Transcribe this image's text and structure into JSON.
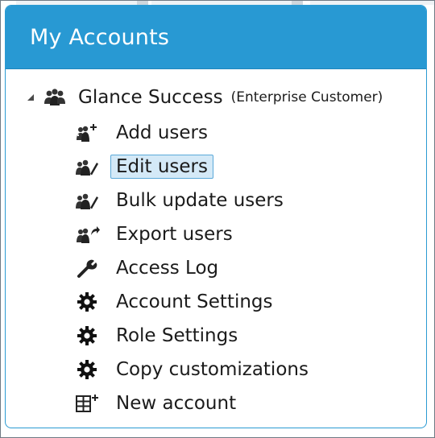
{
  "panel": {
    "title": "My Accounts"
  },
  "tree": {
    "root": {
      "label": "Glance Success",
      "subtitle": "(Enterprise Customer)",
      "expander_icon": "collapse-triangle-icon",
      "icon": "users-group-icon"
    },
    "items": [
      {
        "label": "Add users",
        "icon": "add-users-icon",
        "selected": false
      },
      {
        "label": "Edit users",
        "icon": "edit-users-icon",
        "selected": true
      },
      {
        "label": "Bulk update users",
        "icon": "bulk-update-users-icon",
        "selected": false
      },
      {
        "label": "Export users",
        "icon": "export-users-icon",
        "selected": false
      },
      {
        "label": "Access Log",
        "icon": "wrench-icon",
        "selected": false
      },
      {
        "label": "Account Settings",
        "icon": "gear-icon",
        "selected": false
      },
      {
        "label": "Role Settings",
        "icon": "gear-icon",
        "selected": false
      },
      {
        "label": "Copy customizations",
        "icon": "gear-icon",
        "selected": false
      },
      {
        "label": "New account",
        "icon": "new-account-icon",
        "selected": false
      }
    ]
  },
  "colors": {
    "header_bg": "#2899d3",
    "header_text": "#ffffff",
    "selected_bg": "#d4e9f7",
    "selected_border": "#5ba9d9"
  }
}
